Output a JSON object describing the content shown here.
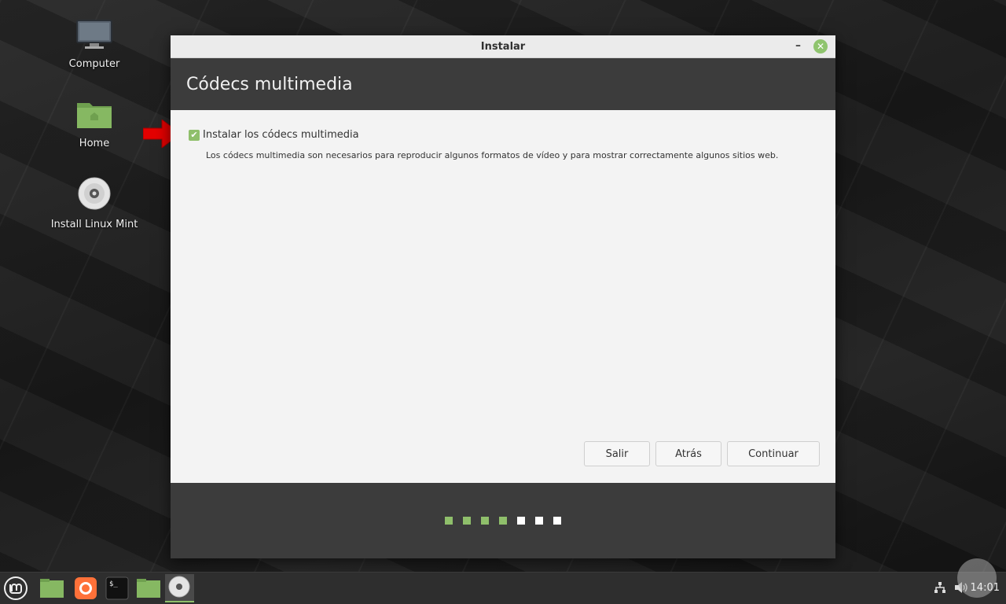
{
  "desktop": {
    "icons": [
      {
        "label": "Computer"
      },
      {
        "label": "Home"
      },
      {
        "label": "Install Linux Mint"
      }
    ]
  },
  "window": {
    "title": "Instalar",
    "minimize_glyph": "–",
    "close_glyph": "✕",
    "heading": "Códecs multimedia",
    "checkbox": {
      "label": "Instalar los códecs multimedia",
      "checked": true
    },
    "description": "Los códecs multimedia son necesarios para reproducir algunos formatos de vídeo y para mostrar correctamente algunos sitios web.",
    "buttons": {
      "quit": "Salir",
      "back": "Atrás",
      "continue": "Continuar"
    },
    "progress": {
      "completed_steps": 4,
      "total_steps": 7
    }
  },
  "taskbar": {
    "clock": "14:01"
  },
  "colors": {
    "accent_green": "#8fbf6b",
    "header_dark": "#3c3c3c",
    "arrow_red": "#e30000"
  },
  "icons": [
    "mint-menu-icon",
    "files-icon",
    "firefox-icon",
    "terminal-icon",
    "folder-icon",
    "disc-icon",
    "network-icon",
    "volume-icon"
  ]
}
